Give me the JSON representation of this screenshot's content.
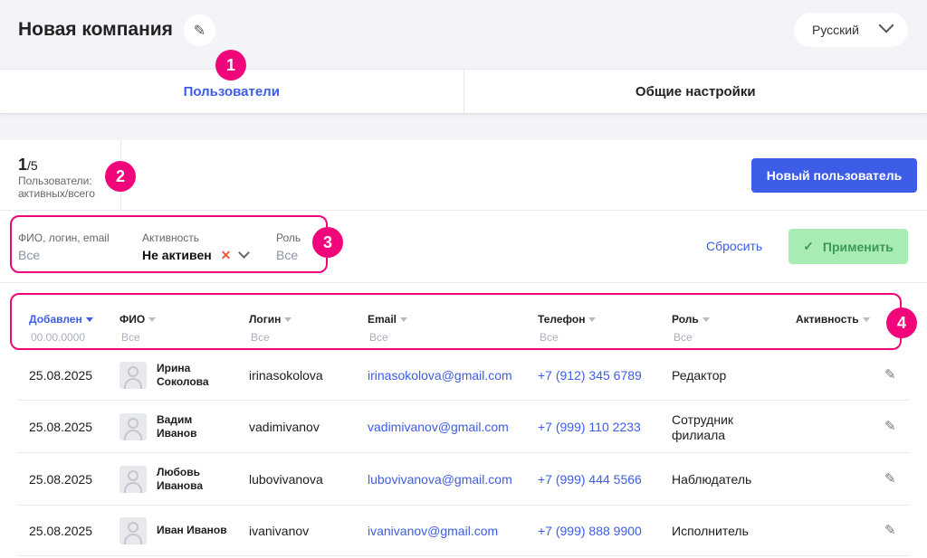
{
  "header": {
    "title": "Новая компания",
    "language": "Русский"
  },
  "tabs": [
    {
      "label": "Пользователи",
      "active": true
    },
    {
      "label": "Общие настройки",
      "active": false
    }
  ],
  "badges": [
    "1",
    "2",
    "3",
    "4"
  ],
  "stats": {
    "active": "1",
    "total": "/5",
    "label_line1": "Пользователи:",
    "label_line2": "активных/всего"
  },
  "new_user_button": "Новый пользователь",
  "filters": [
    {
      "label": "ФИО, логин, email",
      "value": "Все"
    },
    {
      "label": "Активность",
      "value": "Не активен"
    },
    {
      "label": "Роль",
      "value": "Все"
    }
  ],
  "reset_label": "Сбросить",
  "apply_label": "Применить",
  "columns": [
    {
      "label": "Добавлен",
      "filter": "00.00.0000"
    },
    {
      "label": "ФИО",
      "filter": "Все"
    },
    {
      "label": "Логин",
      "filter": "Все"
    },
    {
      "label": "Email",
      "filter": "Все"
    },
    {
      "label": "Телефон",
      "filter": "Все"
    },
    {
      "label": "Роль",
      "filter": "Все"
    },
    {
      "label": "Активность",
      "filter": ""
    }
  ],
  "rows": [
    {
      "date": "25.08.2025",
      "name1": "Ирина",
      "name2": "Соколова",
      "login": "irinasokolova",
      "email": "irinasokolova@gmail.com",
      "phone": "+7 (912) 345 6789",
      "role1": "Редактор",
      "role2": ""
    },
    {
      "date": "25.08.2025",
      "name1": "Вадим",
      "name2": "Иванов",
      "login": "vadimivanov",
      "email": "vadimivanov@gmail.com",
      "phone": "+7 (999) 110 2233",
      "role1": "Сотрудник",
      "role2": "филиала"
    },
    {
      "date": "25.08.2025",
      "name1": "Любовь",
      "name2": "Иванова",
      "login": "lubovivanova",
      "email": "lubovivanova@gmail.com",
      "phone": "+7 (999) 444 5566",
      "role1": "Наблюдатель",
      "role2": ""
    },
    {
      "date": "25.08.2025",
      "name1": "Иван Иванов",
      "name2": "",
      "login": "ivanivanov",
      "email": "ivanivanov@gmail.com",
      "phone": "+7 (999) 888 9900",
      "role1": "Исполнитель",
      "role2": ""
    }
  ],
  "colors": {
    "accent": "#3d5ce8",
    "highlight": "#f0057a",
    "apply_bg": "#a8ecb4"
  }
}
